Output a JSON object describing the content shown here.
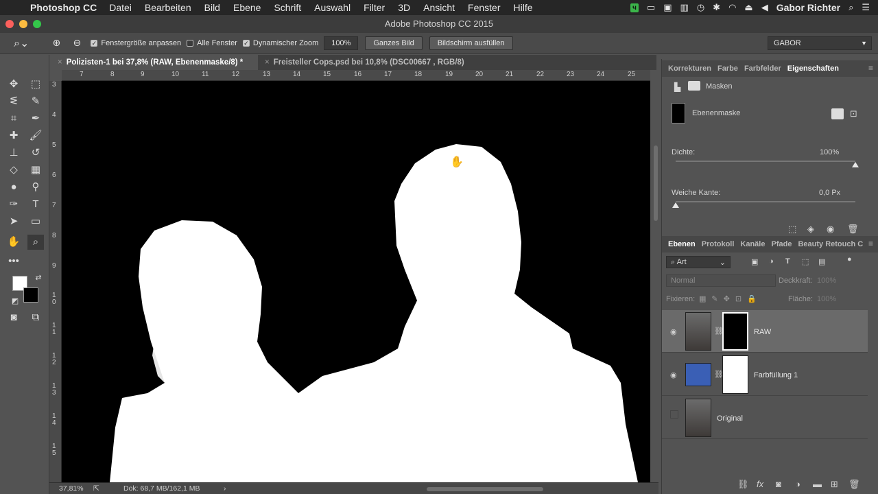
{
  "menubar": {
    "app": "Photoshop CC",
    "items": [
      "Datei",
      "Bearbeiten",
      "Bild",
      "Ebene",
      "Schrift",
      "Auswahl",
      "Filter",
      "3D",
      "Ansicht",
      "Fenster",
      "Hilfe"
    ],
    "user": "Gabor Richter"
  },
  "window": {
    "title": "Adobe Photoshop CC 2015"
  },
  "options": {
    "fit_window": "Fenstergröße anpassen",
    "all_windows": "Alle Fenster",
    "dynamic_zoom": "Dynamischer Zoom",
    "zoom_value": "100%",
    "fit_screen": "Ganzes Bild",
    "fill_screen": "Bildschirm ausfüllen",
    "workspace": "GABOR"
  },
  "tabs": [
    {
      "label": "Polizisten-1 bei 37,8% (RAW, Ebenenmaske/8) *"
    },
    {
      "label": "Freisteller Cops.psd bei 10,8% (DSC00667 , RGB/8)"
    }
  ],
  "ruler": {
    "h": [
      "7",
      "8",
      "9",
      "10",
      "11",
      "12",
      "13",
      "14",
      "15",
      "16",
      "17",
      "18",
      "19",
      "20",
      "21",
      "22",
      "23",
      "24",
      "25"
    ],
    "v": [
      "3",
      "4",
      "5",
      "6",
      "7",
      "8",
      "9",
      "10",
      "11",
      "12",
      "13",
      "14",
      "15"
    ]
  },
  "status": {
    "zoom": "37,81%",
    "doc": "Dok: 68,7 MB/162,1 MB"
  },
  "properties": {
    "tabs": [
      "Korrekturen",
      "Farbe",
      "Farbfelder",
      "Eigenschaften"
    ],
    "section": "Masken",
    "mask_type": "Ebenenmaske",
    "density_label": "Dichte:",
    "density_value": "100%",
    "density": 1.0,
    "feather_label": "Weiche Kante:",
    "feather_value": "0,0 Px",
    "feather": 0.0
  },
  "layers": {
    "tabs": [
      "Ebenen",
      "Protokoll",
      "Kanäle",
      "Pfade",
      "Beauty Retouch C"
    ],
    "filter": "Art",
    "blend": "Normal",
    "opacity_label": "Deckkraft:",
    "opacity": "100%",
    "lock_label": "Fixieren:",
    "fill_label": "Fläche:",
    "fill": "100%",
    "items": [
      {
        "name": "RAW"
      },
      {
        "name": "Farbfüllung 1"
      },
      {
        "name": "Original"
      }
    ]
  },
  "colors": {
    "fill_layer": "#3a5fb5",
    "accent": "#3bb54a"
  }
}
